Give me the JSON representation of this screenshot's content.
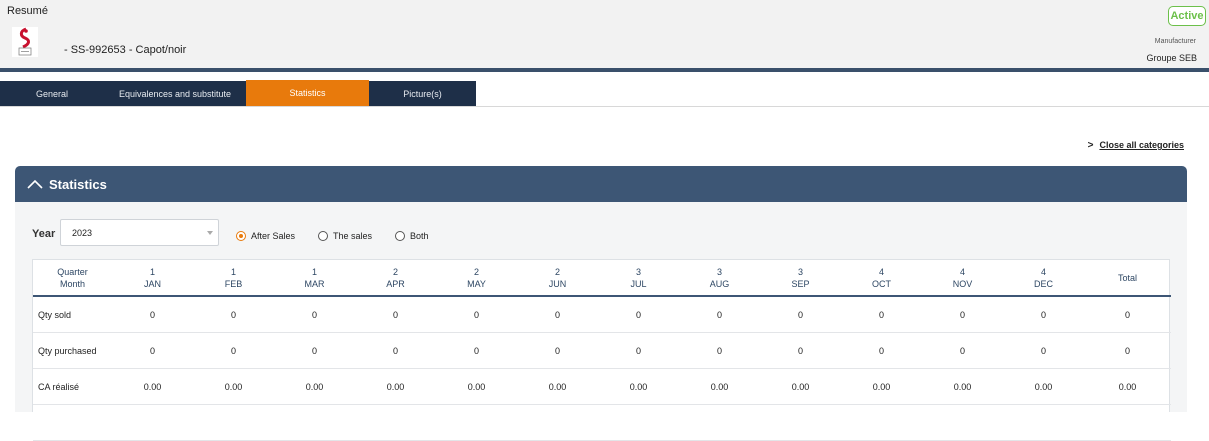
{
  "header": {
    "resume_label": "Resumé",
    "product_name": "- SS-992653 - Capot/noir",
    "status": "Active",
    "manufacturer_label": "Manufacturer",
    "manufacturer_value": "Groupe SEB"
  },
  "colors": {
    "accent": "#e87a0c",
    "navy": "#1e2f48",
    "section": "#3d5675",
    "status_green": "#6cc04a",
    "logo_red": "#c8102e"
  },
  "tabs": [
    {
      "label": "General",
      "active": false
    },
    {
      "label": "Equivalences and substitute",
      "active": false
    },
    {
      "label": "Statistics",
      "active": true
    },
    {
      "label": "Picture(s)",
      "active": false
    }
  ],
  "close_all_label": "Close all categories",
  "section": {
    "title": "Statistics",
    "icon": "chevron-up-icon"
  },
  "filters": {
    "year_label": "Year",
    "year_value": "2023",
    "radios": [
      {
        "label": "After Sales",
        "checked": true
      },
      {
        "label": "The sales",
        "checked": false
      },
      {
        "label": "Both",
        "checked": false
      }
    ]
  },
  "table": {
    "corner": {
      "line1": "Quarter",
      "line2": "Month"
    },
    "columns": [
      {
        "quarter": "1",
        "month": "JAN"
      },
      {
        "quarter": "1",
        "month": "FEB"
      },
      {
        "quarter": "1",
        "month": "MAR"
      },
      {
        "quarter": "2",
        "month": "APR"
      },
      {
        "quarter": "2",
        "month": "MAY"
      },
      {
        "quarter": "2",
        "month": "JUN"
      },
      {
        "quarter": "3",
        "month": "JUL"
      },
      {
        "quarter": "3",
        "month": "AUG"
      },
      {
        "quarter": "3",
        "month": "SEP"
      },
      {
        "quarter": "4",
        "month": "OCT"
      },
      {
        "quarter": "4",
        "month": "NOV"
      },
      {
        "quarter": "4",
        "month": "DEC"
      }
    ],
    "total_label": "Total",
    "rows": [
      {
        "label": "Qty sold",
        "values": [
          "0",
          "0",
          "0",
          "0",
          "0",
          "0",
          "0",
          "0",
          "0",
          "0",
          "0",
          "0"
        ],
        "total": "0"
      },
      {
        "label": "Qty purchased",
        "values": [
          "0",
          "0",
          "0",
          "0",
          "0",
          "0",
          "0",
          "0",
          "0",
          "0",
          "0",
          "0"
        ],
        "total": "0"
      },
      {
        "label": "CA réalisé",
        "values": [
          "0.00",
          "0.00",
          "0.00",
          "0.00",
          "0.00",
          "0.00",
          "0.00",
          "0.00",
          "0.00",
          "0.00",
          "0.00",
          "0.00"
        ],
        "total": "0.00"
      }
    ]
  }
}
